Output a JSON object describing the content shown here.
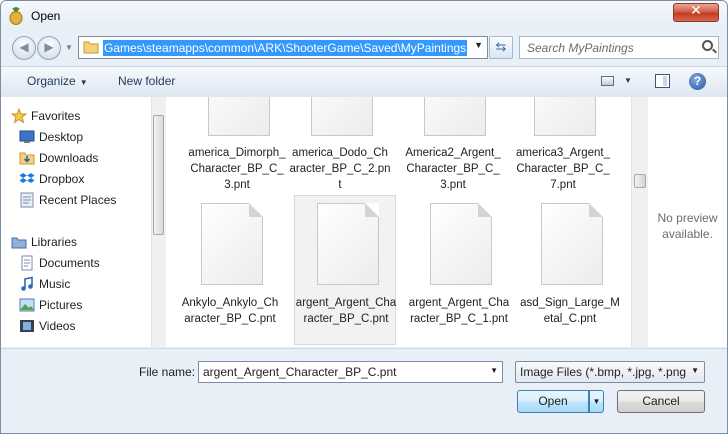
{
  "window": {
    "title": "Open",
    "close_glyph": "✕"
  },
  "address_bar": {
    "path": "Games\\steamapps\\common\\ARK\\ShooterGame\\Saved\\MyPaintings",
    "back_glyph": "◀",
    "forward_glyph": "▶",
    "dropdown_glyph": "▼"
  },
  "search": {
    "placeholder": "Search MyPaintings"
  },
  "toolbar": {
    "organize_label": "Organize",
    "new_folder_label": "New folder",
    "caret": "▼",
    "help_glyph": "?"
  },
  "nav": {
    "favorites_label": "Favorites",
    "favorites": [
      "Desktop",
      "Downloads",
      "Dropbox",
      "Recent Places"
    ],
    "libraries_label": "Libraries",
    "libraries": [
      "Documents",
      "Music",
      "Pictures",
      "Videos"
    ]
  },
  "files": [
    {
      "name": "america_Dimorph_Character_BP_C_3.pnt"
    },
    {
      "name": "america_Dodo_Character_BP_C_2.pnt"
    },
    {
      "name": "America2_Argent_Character_BP_C_3.pnt"
    },
    {
      "name": "america3_Argent_Character_BP_C_7.pnt"
    },
    {
      "name": "Ankylo_Ankylo_Character_BP_C.pnt"
    },
    {
      "name": "argent_Argent_Character_BP_C.pnt",
      "selected": true
    },
    {
      "name": "argent_Argent_Character_BP_C_1.pnt"
    },
    {
      "name": "asd_Sign_Large_Metal_C.pnt"
    }
  ],
  "preview": {
    "text": "No preview available."
  },
  "footer": {
    "file_name_label": "File name:",
    "file_name_value": "argent_Argent_Character_BP_C.pnt",
    "file_type_value": "Image Files (*.bmp, *.jpg, *.png",
    "open_label": "Open",
    "cancel_label": "Cancel",
    "dropdown_glyph": "▼"
  }
}
